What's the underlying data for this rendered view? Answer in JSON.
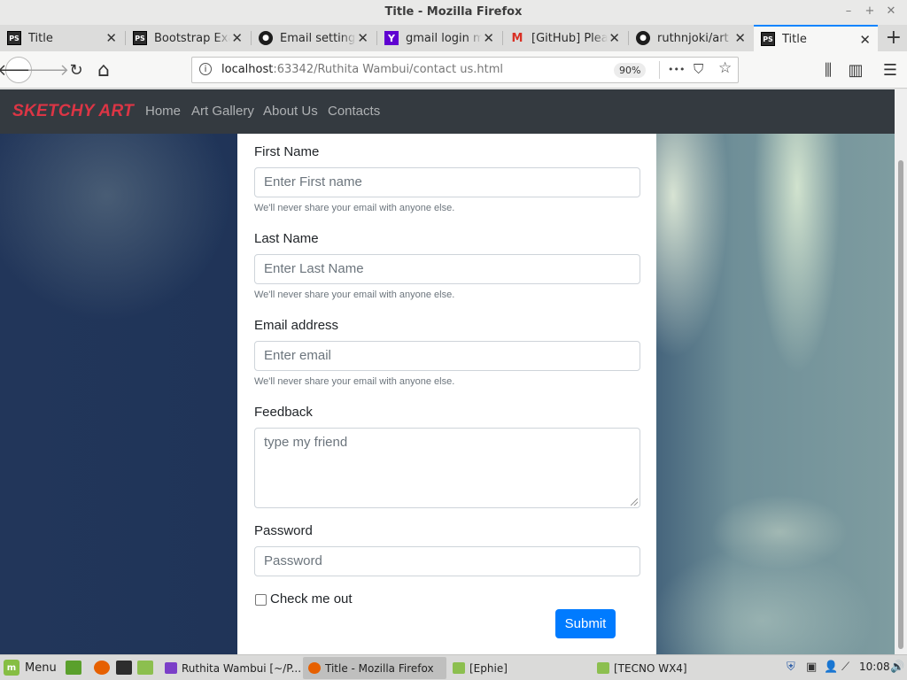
{
  "window": {
    "title": "Title - Mozilla Firefox",
    "controls": [
      "–",
      "+",
      "✕"
    ]
  },
  "tabs": [
    {
      "label": "Title",
      "icon": "phpstorm-icon",
      "active": false
    },
    {
      "label": "Bootstrap Exa",
      "icon": "phpstorm-icon",
      "active": false
    },
    {
      "label": "Email settings",
      "icon": "github-icon",
      "active": false
    },
    {
      "label": "gmail login ma",
      "icon": "yahoo-icon",
      "active": false
    },
    {
      "label": "[GitHub] Pleas",
      "icon": "gmail-icon",
      "active": false
    },
    {
      "label": "ruthnjoki/art",
      "icon": "github-icon",
      "active": false
    },
    {
      "label": "Title",
      "icon": "phpstorm-icon",
      "active": true
    }
  ],
  "toolbar": {
    "back": "🡐",
    "forward": "🡒",
    "reload": "↻",
    "home": "⌂",
    "url_host": "localhost",
    "url_rest": ":63342/Ruthita Wambui/contact us.html",
    "zoom": "90%",
    "more": "•••",
    "pocket": "⛉",
    "bookmark": "☆",
    "library": "⫼",
    "sidebar": "▥",
    "menu": "☰"
  },
  "site": {
    "brand": "SKETCHY ART",
    "nav": [
      "Home",
      "Art Gallery",
      "About Us",
      "Contacts"
    ],
    "brand_color": "#dc3545",
    "accent_color": "#007bff"
  },
  "form": {
    "first_name": {
      "label": "First Name",
      "placeholder": "Enter First name",
      "help": "We'll never share your email with anyone else."
    },
    "last_name": {
      "label": "Last Name",
      "placeholder": "Enter Last Name",
      "help": "We'll never share your email with anyone else."
    },
    "email": {
      "label": "Email address",
      "placeholder": "Enter email",
      "help": "We'll never share your email with anyone else."
    },
    "feedback": {
      "label": "Feedback",
      "placeholder": "type my friend"
    },
    "password": {
      "label": "Password",
      "placeholder": "Password"
    },
    "check_label": "Check me out",
    "submit": "Submit"
  },
  "taskbar": {
    "menu": "Menu",
    "items": [
      {
        "label": "Ruthita Wambui [~/P...",
        "active": false
      },
      {
        "label": "Title - Mozilla Firefox",
        "active": true
      },
      {
        "label": "[Ephie]",
        "active": false
      },
      {
        "label": "[TECNO WX4]",
        "active": false
      }
    ],
    "clock": "10:08"
  }
}
